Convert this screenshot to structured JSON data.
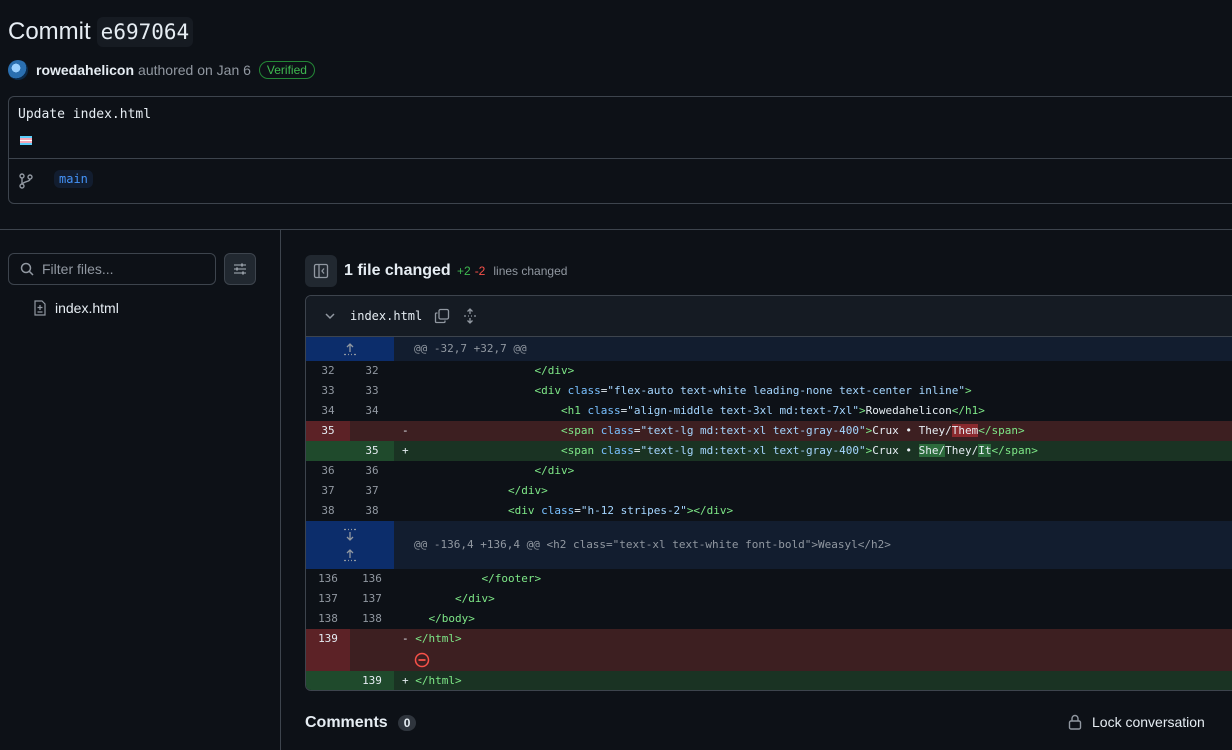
{
  "commit": {
    "title_prefix": "Commit",
    "sha": "e697064",
    "author": "rowedahelicon",
    "authored_text": "authored on Jan 6",
    "verified_badge": "Verified",
    "message": "Update index.html",
    "branch": "main"
  },
  "sidebar": {
    "filter_placeholder": "Filter files...",
    "files": [
      "index.html"
    ]
  },
  "summary": {
    "files_changed": "1 file changed",
    "additions": "+2",
    "deletions": "-2",
    "lines_changed_label": "lines changed"
  },
  "diff": {
    "filename": "index.html",
    "hunk1": "@@ -32,7 +32,7 @@",
    "hunk2_prefix": "@@ -136,4 +136,4 @@ ",
    "hunk2_context": "<h2 class=\"text-xl text-white font-bold\">Weasyl</h2>",
    "lines": {
      "l32": {
        "old": "32",
        "new": "32"
      },
      "l33": {
        "old": "33",
        "new": "33"
      },
      "l34": {
        "old": "34",
        "new": "34"
      },
      "l35d": {
        "old": "35",
        "sign": "-"
      },
      "l35a": {
        "new": "35",
        "sign": "+"
      },
      "l36": {
        "old": "36",
        "new": "36"
      },
      "l37": {
        "old": "37",
        "new": "37"
      },
      "l38": {
        "old": "38",
        "new": "38"
      },
      "l136": {
        "old": "136",
        "new": "136"
      },
      "l137": {
        "old": "137",
        "new": "137"
      },
      "l138": {
        "old": "138",
        "new": "138"
      },
      "l139d": {
        "old": "139",
        "sign": "-"
      },
      "l139a": {
        "new": "139",
        "sign": "+"
      }
    },
    "text": {
      "div_close": "</div>",
      "div_open_attr": "flex-auto text-white leading-none text-center inline",
      "h1_attr": "align-middle text-3xl md:text-7xl",
      "h1_text": "Rowedahelicon",
      "span_attr": "text-lg md:text-xl text-gray-400",
      "span_del_pre": "Crux • They/",
      "span_del_hl": "Them",
      "span_add_pre": "Crux • ",
      "span_add_hl1": "She/",
      "span_add_mid": "They/",
      "span_add_hl2": "It",
      "stripes_attr": "h-12 stripes-2",
      "footer_close": "</footer>",
      "body_close": "</body>",
      "html_close": "</html>"
    }
  },
  "comments": {
    "label": "Comments",
    "count": "0",
    "lock_label": "Lock conversation"
  },
  "colors": {
    "background": "#0d1117",
    "border": "#3d444d",
    "accent": "#4493f8",
    "addition": "#3fb950",
    "deletion": "#f85149"
  }
}
